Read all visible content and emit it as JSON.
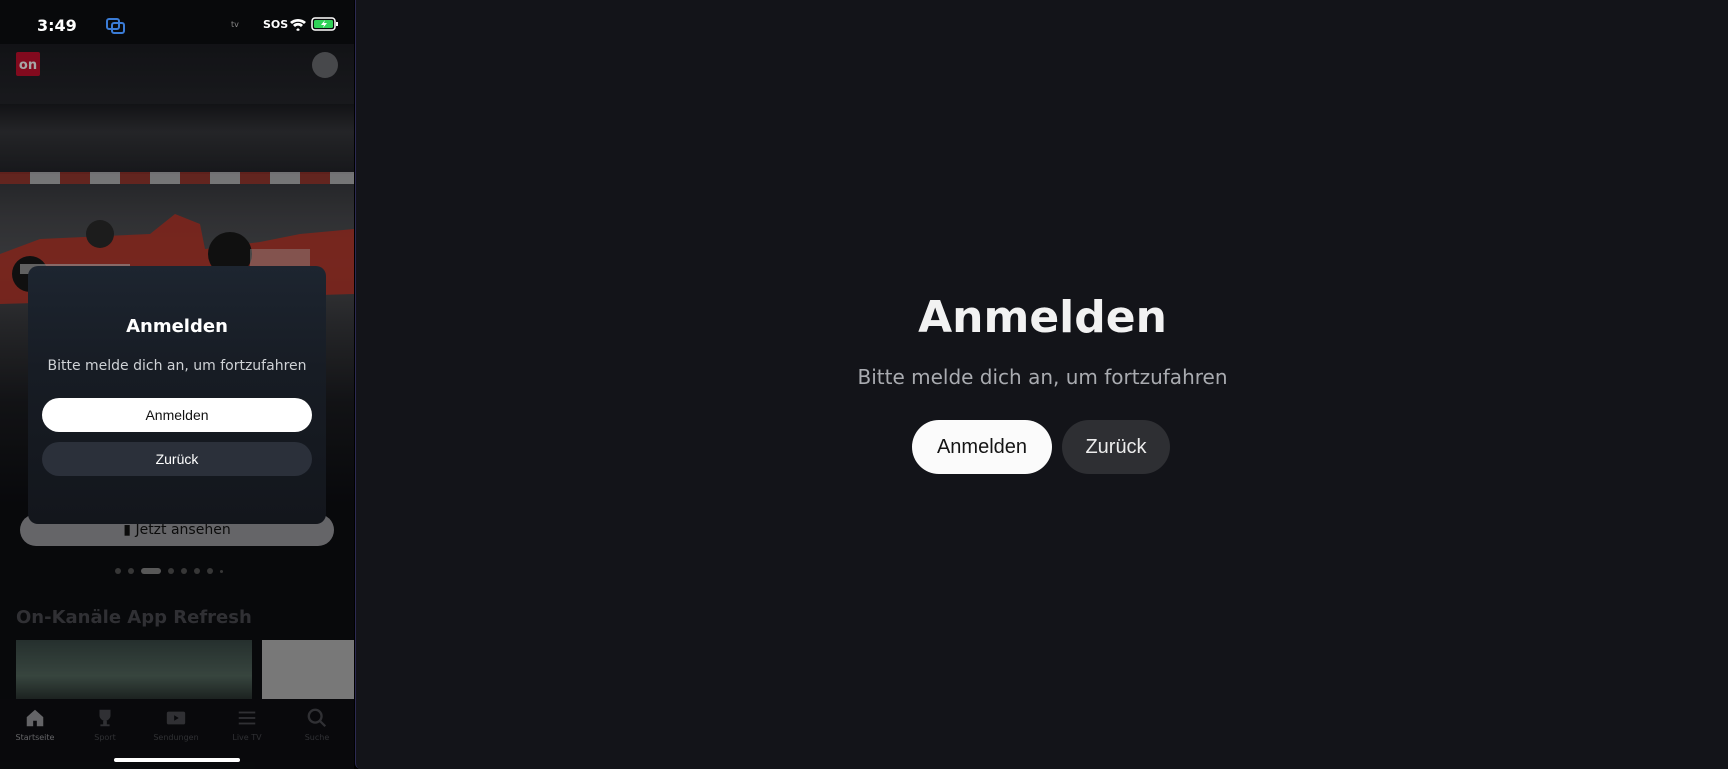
{
  "statusbar": {
    "time": "3:49",
    "carrier_label": "SOS",
    "appletv_label": "tv"
  },
  "phone": {
    "logo_text": "on",
    "watch_button": "Jetzt ansehen",
    "section_title": "On-Kanäle App Refresh",
    "carousel": {
      "count": 8,
      "active_index": 2
    },
    "tabs": [
      {
        "label": "Startseite",
        "icon": "home-icon",
        "active": true
      },
      {
        "label": "Sport",
        "icon": "trophy-icon",
        "active": false
      },
      {
        "label": "Sendungen",
        "icon": "play-icon",
        "active": false
      },
      {
        "label": "Live TV",
        "icon": "list-icon",
        "active": false
      },
      {
        "label": "Suche",
        "icon": "search-icon",
        "active": false
      }
    ],
    "dialog": {
      "title": "Anmelden",
      "message": "Bitte melde dich an, um fortzufahren",
      "primary": "Anmelden",
      "secondary": "Zurück"
    }
  },
  "tv": {
    "title": "Anmelden",
    "message": "Bitte melde dich an, um fortzufahren",
    "primary": "Anmelden",
    "secondary": "Zurück"
  },
  "colors": {
    "accent": "#c8102e",
    "tv_background": "#131419",
    "battery_charging": "#30d158"
  }
}
